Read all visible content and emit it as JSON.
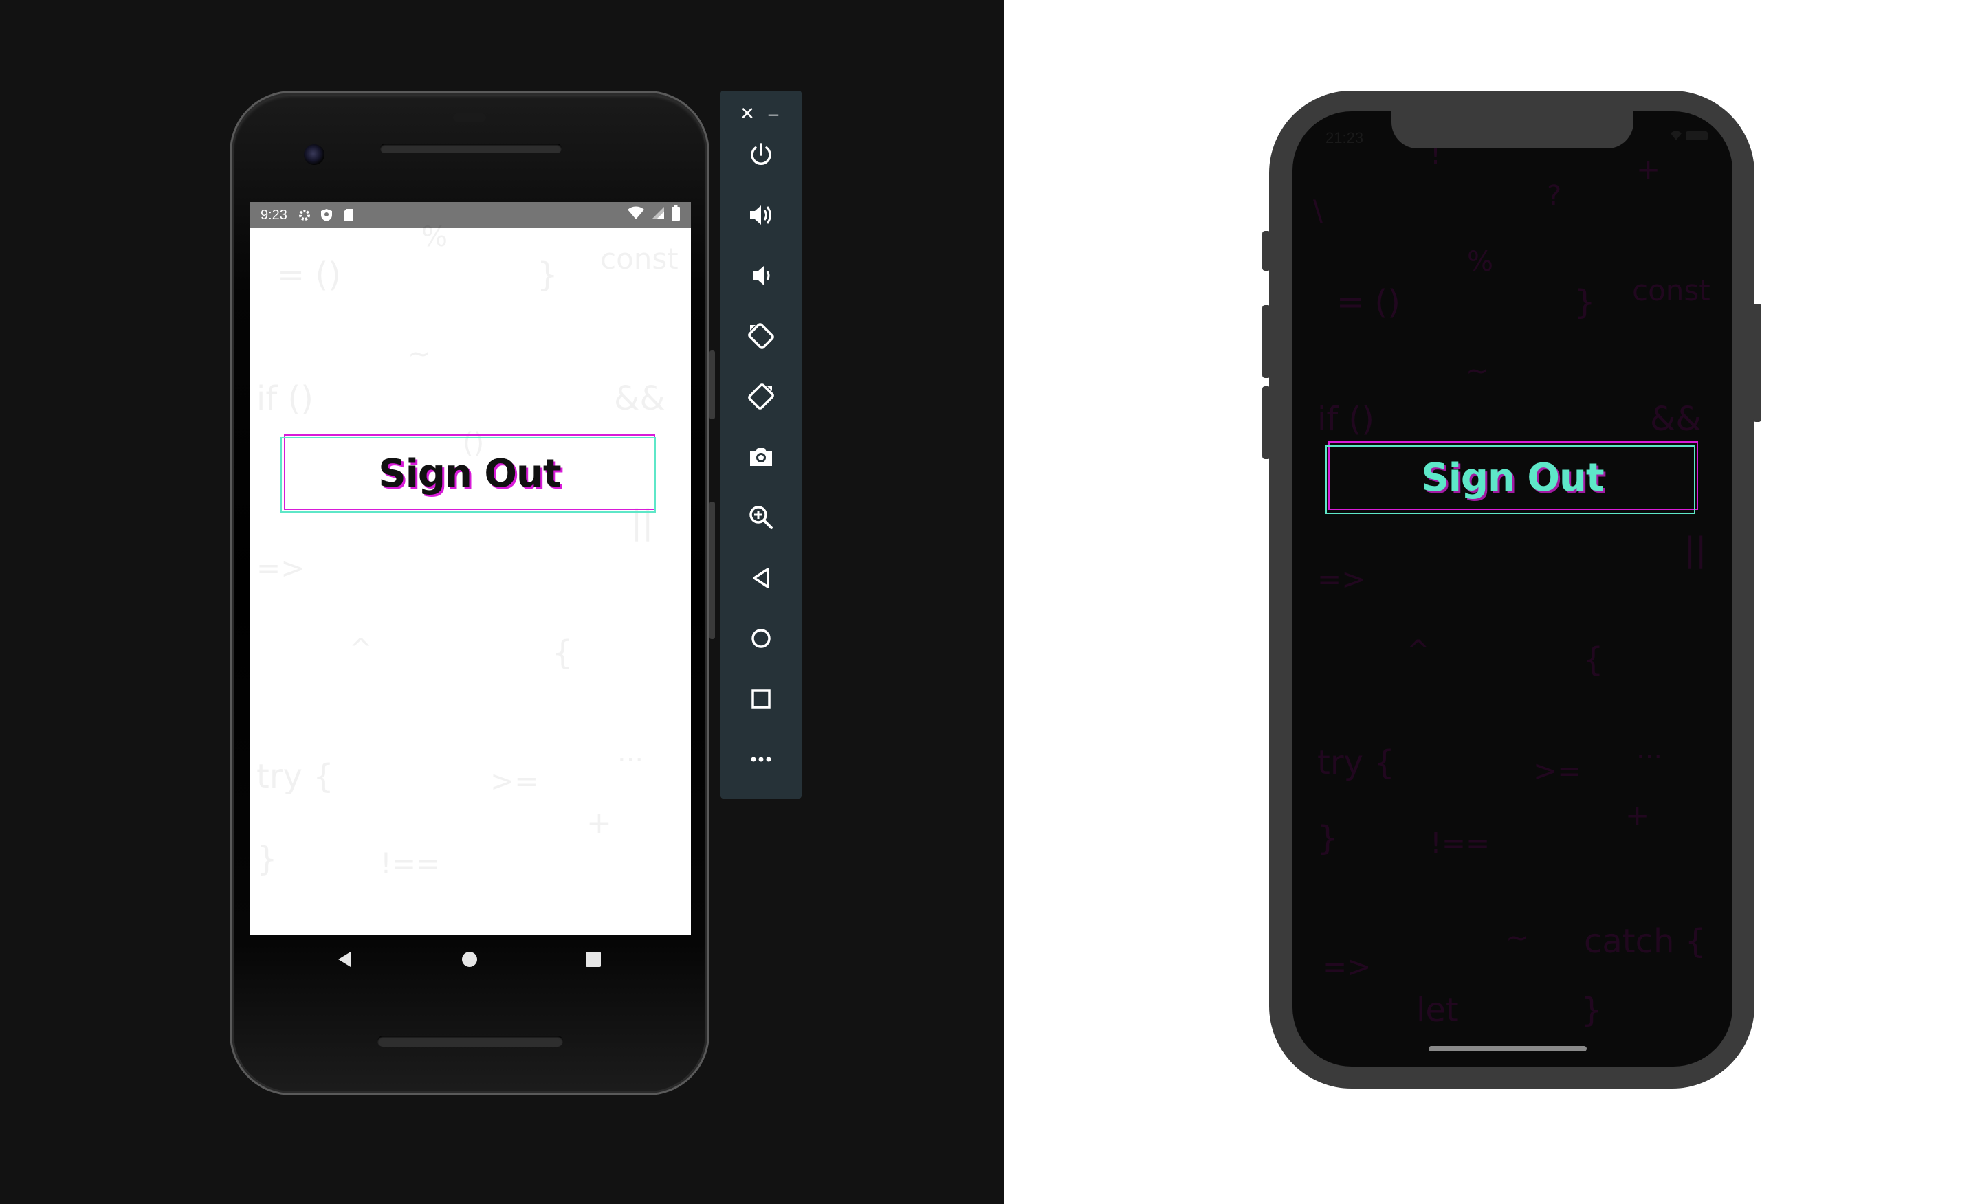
{
  "android": {
    "status_bar": {
      "time": "9:23",
      "left_icons": [
        "gear-icon",
        "shield-icon",
        "sd-card-icon"
      ],
      "right_icons": [
        "wifi-icon",
        "signal-icon",
        "battery-icon"
      ]
    },
    "background_glyphs": [
      "%",
      "= ()",
      "}",
      "const",
      "~",
      "if ()",
      "&&",
      "()",
      "||",
      "=>",
      "^",
      "{",
      "...",
      "try {",
      ">=",
      "+",
      "}",
      "!=="
    ],
    "sign_out_label": "Sign Out",
    "nav_buttons": [
      "back-triangle-icon",
      "home-circle-icon",
      "overview-square-icon"
    ]
  },
  "emulator_toolbar": {
    "close": "✕",
    "minimize": "–",
    "buttons": [
      "power-icon",
      "volume-up-icon",
      "volume-down-icon",
      "rotate-left-icon",
      "rotate-right-icon",
      "camera-icon",
      "zoom-icon",
      "back-icon",
      "home-icon",
      "overview-icon",
      "more-icon"
    ]
  },
  "iphone": {
    "status_bar": {
      "time": "21:23"
    },
    "background_glyphs": [
      "!",
      "+",
      "\\",
      "?",
      "%",
      "= ()",
      "}",
      "const",
      "~",
      "if ()",
      "&&",
      "||",
      "=>",
      "^",
      "{",
      "try {",
      ">=",
      "...",
      "}",
      "+",
      "!==",
      "~",
      "catch {",
      "=>",
      "let",
      "}"
    ],
    "sign_out_label": "Sign Out"
  },
  "colors": {
    "left_background": "#121212",
    "right_background": "#ffffff",
    "android_screen": "#ffffff",
    "android_status_bar": "#757575",
    "toolbar": "#263238",
    "iphone_frame": "#3b3b3b",
    "iphone_screen": "#0a0a0a",
    "accent_magenta": "#d81bd8",
    "accent_teal": "#5ee7c8"
  }
}
